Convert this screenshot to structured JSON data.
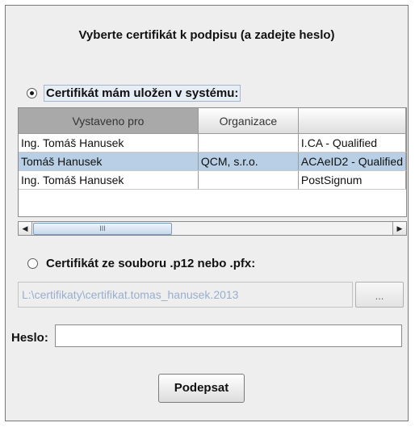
{
  "dialog": {
    "title": "Vyberte certifikát k podpisu (a zadejte heslo)",
    "option_system": {
      "label": "Certifikát mám uložen v systému:",
      "selected": true
    },
    "table": {
      "columns": [
        "Vystaveno pro",
        "Organizace",
        ""
      ],
      "rows": [
        {
          "issued_to": "Ing. Tomáš Hanusek",
          "organization": "",
          "issuer": "I.CA - Qualified"
        },
        {
          "issued_to": "Tomáš Hanusek",
          "organization": "QCM, s.r.o.",
          "issuer": "ACAeID2 - Qualified"
        },
        {
          "issued_to": "Ing. Tomáš Hanusek",
          "organization": "",
          "issuer": "PostSignum"
        }
      ],
      "selected_row": 1
    },
    "scrollbar": {
      "thumb_grip": "III",
      "left_icon": "arrow-left-icon",
      "right_icon": "arrow-right-icon"
    },
    "option_file": {
      "label": "Certifikát ze souboru .p12 nebo .pfx:",
      "selected": false
    },
    "file_path": "L:\\certifikaty\\certifikat.tomas_hanusek.2013",
    "browse_label": "...",
    "password_label": "Heslo:",
    "password_value": "",
    "sign_button": "Podepsat"
  }
}
